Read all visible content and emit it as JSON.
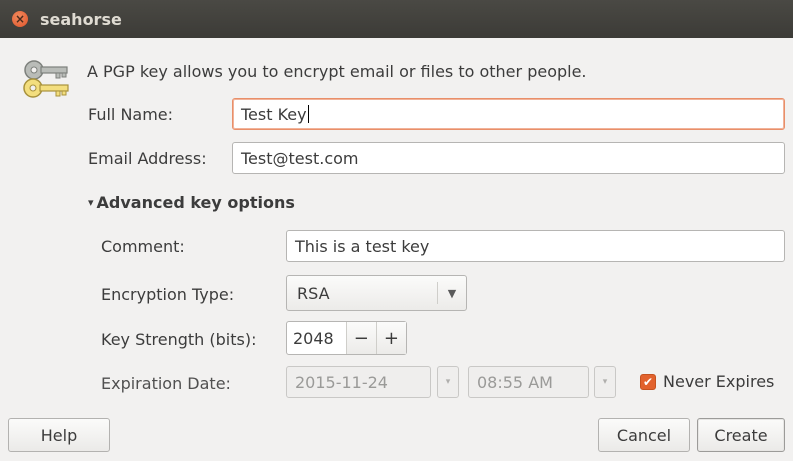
{
  "window": {
    "title": "seahorse",
    "close_symbol": "×"
  },
  "intro": {
    "text": "A PGP key allows you to encrypt email or files to other people."
  },
  "form": {
    "full_name_label": "Full Name:",
    "full_name_value": "Test Key",
    "email_label": "Email Address:",
    "email_value": "Test@test.com"
  },
  "advanced": {
    "expander_arrow": "▾",
    "expander_label": "Advanced key options",
    "comment_label": "Comment:",
    "comment_value": "This is a test key",
    "encryption_label": "Encryption Type:",
    "encryption_value": "RSA",
    "encryption_arrow": "▼",
    "strength_label": "Key Strength (bits):",
    "strength_value": "2048",
    "minus": "−",
    "plus": "+",
    "expiration_label": "Expiration Date:",
    "date_value": "2015-11-24",
    "time_value": "08:55 AM",
    "spin_arrow": "▾",
    "never_expires_label": "Never Expires",
    "never_expires_checked": true
  },
  "buttons": {
    "help": "Help",
    "cancel": "Cancel",
    "create": "Create"
  },
  "colors": {
    "titlebar": "#3c3b37",
    "accent": "#e2622d",
    "focus_border": "#e98f69"
  }
}
